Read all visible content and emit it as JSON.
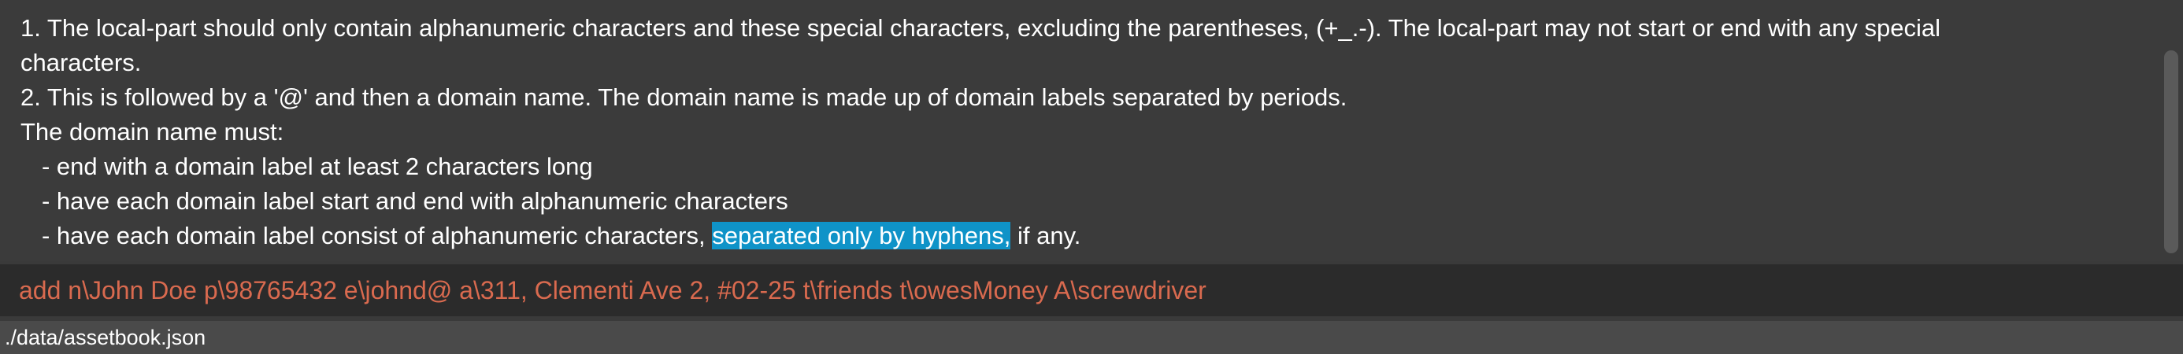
{
  "result_display": {
    "line1": "1. The local-part should only contain alphanumeric characters and these special characters, excluding the parentheses, (+_.-). The local-part may not start or end with any special",
    "line2": "characters.",
    "line3": "2. This is followed by a '@' and then a domain name. The domain name is made up of domain labels separated by periods.",
    "line4": "The domain name must:",
    "line5": "- end with a domain label at least 2 characters long",
    "line6": "- have each domain label start and end with alphanumeric characters",
    "line7_before": "- have each domain label consist of alphanumeric characters, ",
    "line7_selected": "separated only by hyphens,",
    "line7_after": " if any."
  },
  "command_box": {
    "value": "add n\\John Doe p\\98765432 e\\johnd@ a\\311, Clementi Ave 2, #02-25 t\\friends t\\owesMoney A\\screwdriver",
    "text_color": "#d96a4f"
  },
  "status_bar": {
    "file_path": "./data/assetbook.json"
  },
  "colors": {
    "selection": "#0f93c8",
    "background": "#3b3b3b",
    "command_background": "#2b2b2b"
  }
}
